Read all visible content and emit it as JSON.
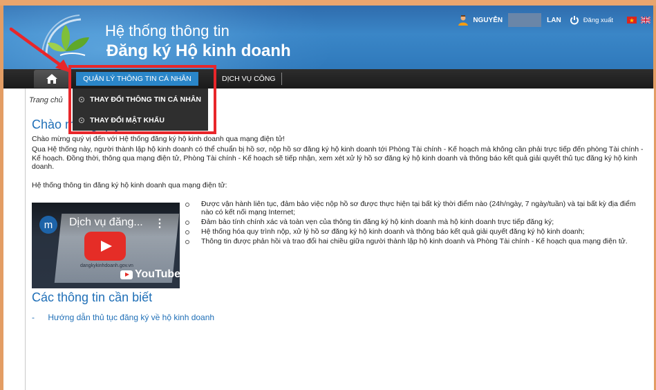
{
  "header": {
    "title_line1": "Hệ thống thông tin",
    "title_line2": "Đăng ký Hộ kinh doanh"
  },
  "userbar": {
    "first_name": "NGUYỄN",
    "last_name": "LAN",
    "logout_label": "Đăng xuất"
  },
  "nav": {
    "active_label": "QUẢN LÝ THÔNG TIN CÁ NHÂN",
    "public_label": "DỊCH VỤ CÔNG"
  },
  "dropdown": {
    "items": [
      "THAY ĐỔI THÔNG TIN CÁ NHÂN",
      "THAY ĐỔI MẬT KHẨU"
    ]
  },
  "breadcrumb": "Trang chủ",
  "welcome": {
    "title": "Chào mừng quý vị",
    "line": "Chào mừng quý vị đến với Hệ thống đăng ký hộ kinh doanh qua mạng điện tử!",
    "para1": "Qua Hệ thống này, người thành lập hộ kinh doanh có thể chuẩn bị hồ sơ, nộp hồ sơ đăng ký hộ kinh doanh tới Phòng Tài chính - Kế hoạch mà không cần phải trực tiếp đến phòng Tài chính - Kế hoạch. Đồng thời, thông qua mạng điện tử, Phòng Tài chính - Kế hoạch sẽ tiếp nhận, xem xét xử lý hồ sơ đăng ký hộ kinh doanh và thông báo kết quả giải quyết thủ tục đăng ký hộ kinh doanh.",
    "para2": "Hệ thống thông tin đăng ký hộ kinh doanh qua mạng điện tử:"
  },
  "video": {
    "avatar_letter": "m",
    "title": "Dịch vụ đăng...",
    "menu": "⋮",
    "youtube_label": "YouTube",
    "caption": "dangkykinhdoanh.gov.vn"
  },
  "bullets": [
    "Được vận hành liên tục, đảm bảo việc nộp hồ sơ được thực hiện tại bất kỳ thời điểm nào (24h/ngày, 7 ngày/tuần) và tại bất kỳ địa điểm nào có kết nối mạng Internet;",
    "Đảm bảo tính chính xác và toàn vẹn của thông tin đăng ký hộ kinh doanh mà hộ kinh doanh trực tiếp đăng ký;",
    "Hệ thống hóa quy trình nộp, xử lý hồ sơ đăng ký hộ kinh doanh và thông báo kết quả giải quyết đăng ký hộ kinh doanh;",
    "Thông tin được phản hồi và trao đổi hai chiều giữa người thành lập hộ kinh doanh và Phòng Tài chính - Kế hoạch qua mạng điện tử."
  ],
  "info": {
    "title": "Các thông tin cần biết",
    "dash": "-",
    "link": "Hướng dẫn thủ tục đăng ký về hộ kinh doanh"
  },
  "colors": {
    "header_blue": "#3a86c7",
    "nav_dark": "#1a1a1a",
    "active_blue": "#2a86c9",
    "highlight_red": "#e8262a",
    "title_blue": "#1f6fb7"
  }
}
